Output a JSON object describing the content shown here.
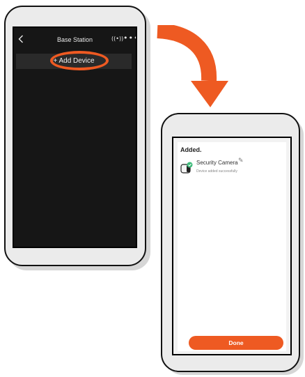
{
  "left_phone": {
    "header": {
      "back_icon": "chevron-left-icon",
      "title": "Base Station",
      "signal_icon": "broadcast-icon",
      "more_icon": "more-horizontal-icon"
    },
    "add_device_label": "+ Add Device"
  },
  "right_phone": {
    "heading": "Added.",
    "device": {
      "icon": "security-camera-icon",
      "status_icon": "check-badge-icon",
      "name": "Security Camera",
      "edit_icon": "pencil-icon",
      "status": "Device added successfully"
    },
    "done_label": "Done"
  },
  "colors": {
    "accent": "#ee5a22",
    "success": "#3dbb7a",
    "dark_screen": "#161616",
    "add_bar": "#2a2a2a"
  }
}
